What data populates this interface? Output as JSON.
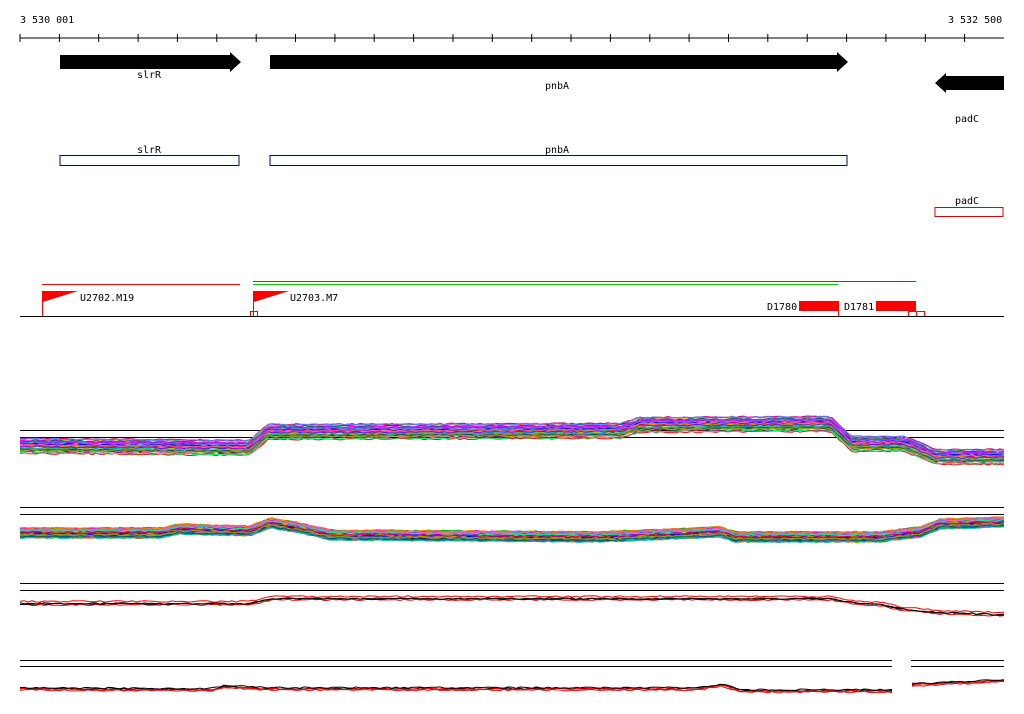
{
  "coordinates": {
    "start": "3 530 001",
    "end": "3 532 500"
  },
  "colors": {
    "gene_arrow": "#000000",
    "cds_box": "#00008b",
    "cds_box_reverse": "#e00000",
    "promoter": "#ff0000",
    "terminator": "#ff0000",
    "transcript_red": "#ff0000",
    "transcript_green": "#00cc00"
  },
  "genes": [
    {
      "name": "slrR",
      "strand": "+"
    },
    {
      "name": "pnbA",
      "strand": "+"
    },
    {
      "name": "padC",
      "strand": "-"
    }
  ],
  "cds": [
    {
      "name": "slrR",
      "strand": "+"
    },
    {
      "name": "pnbA",
      "strand": "+"
    },
    {
      "name": "padC",
      "strand": "-"
    }
  ],
  "regulatory": {
    "promoters": [
      {
        "label": "U2702.M19"
      },
      {
        "label": "U2703.M7"
      }
    ],
    "terminators": [
      {
        "label": "D1780"
      },
      {
        "label": "D1781"
      }
    ]
  },
  "tracks": [
    {
      "id": "expression-track-1",
      "kind": "multi-condition profiles"
    },
    {
      "id": "expression-track-2",
      "kind": "multi-condition profiles"
    },
    {
      "id": "expression-track-3",
      "kind": "strand profiles (black/red)"
    },
    {
      "id": "expression-track-4",
      "kind": "strand profiles (black/red)"
    }
  ],
  "profile_palette": [
    "#000000",
    "#ff0000",
    "#00c000",
    "#0000ff",
    "#ff00ff",
    "#00c0c0",
    "#c0c000",
    "#808080",
    "#ff8000",
    "#8000ff",
    "#00ff80",
    "#c00060",
    "#006060",
    "#6080ff",
    "#a0a000",
    "#ff60a0"
  ]
}
